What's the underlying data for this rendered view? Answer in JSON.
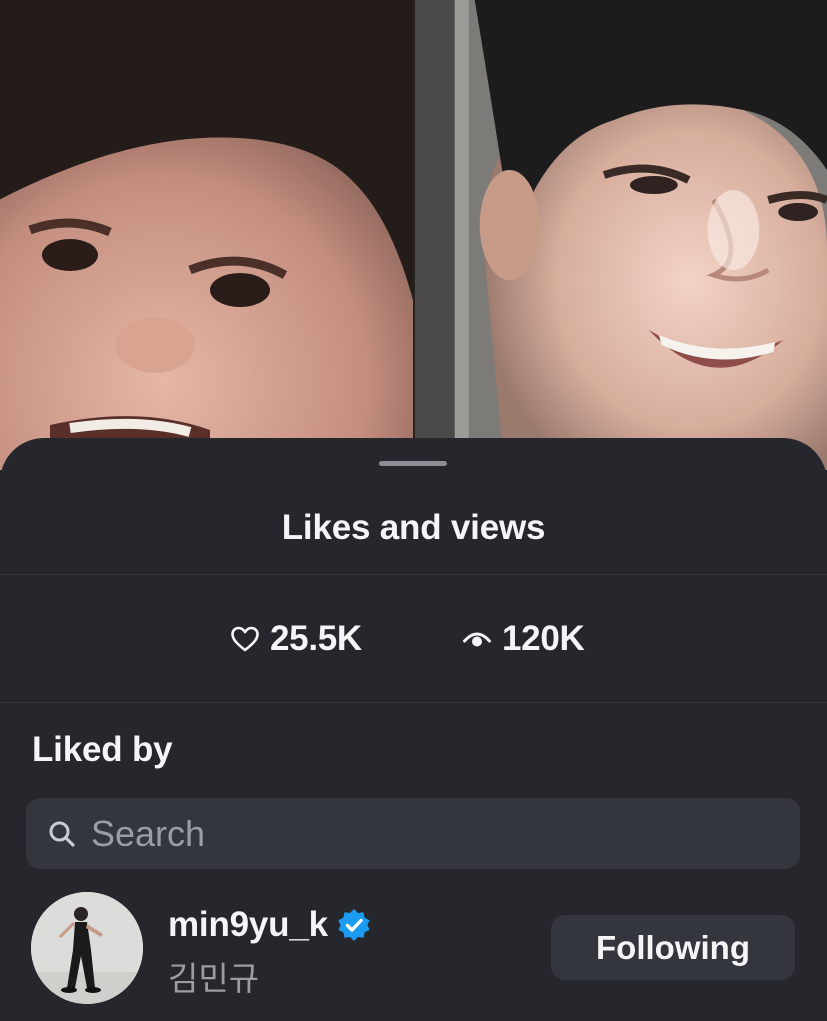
{
  "sheet": {
    "title": "Likes and views"
  },
  "stats": {
    "likes": {
      "icon": "heart-icon",
      "value": "25.5K"
    },
    "views": {
      "icon": "eye-icon",
      "value": "120K"
    }
  },
  "liked_by": {
    "title": "Liked by",
    "search": {
      "placeholder": "Search",
      "value": "",
      "icon": "search-icon"
    },
    "users": [
      {
        "username": "min9yu_k",
        "full_name": "김민규",
        "verified": true,
        "button_label": "Following"
      }
    ]
  },
  "colors": {
    "sheet_background": "#25272c",
    "surface": "#33363c",
    "text_primary": "#f4f5f7",
    "text_secondary": "#9a9da3",
    "verified_badge": "#1d9bf0"
  }
}
